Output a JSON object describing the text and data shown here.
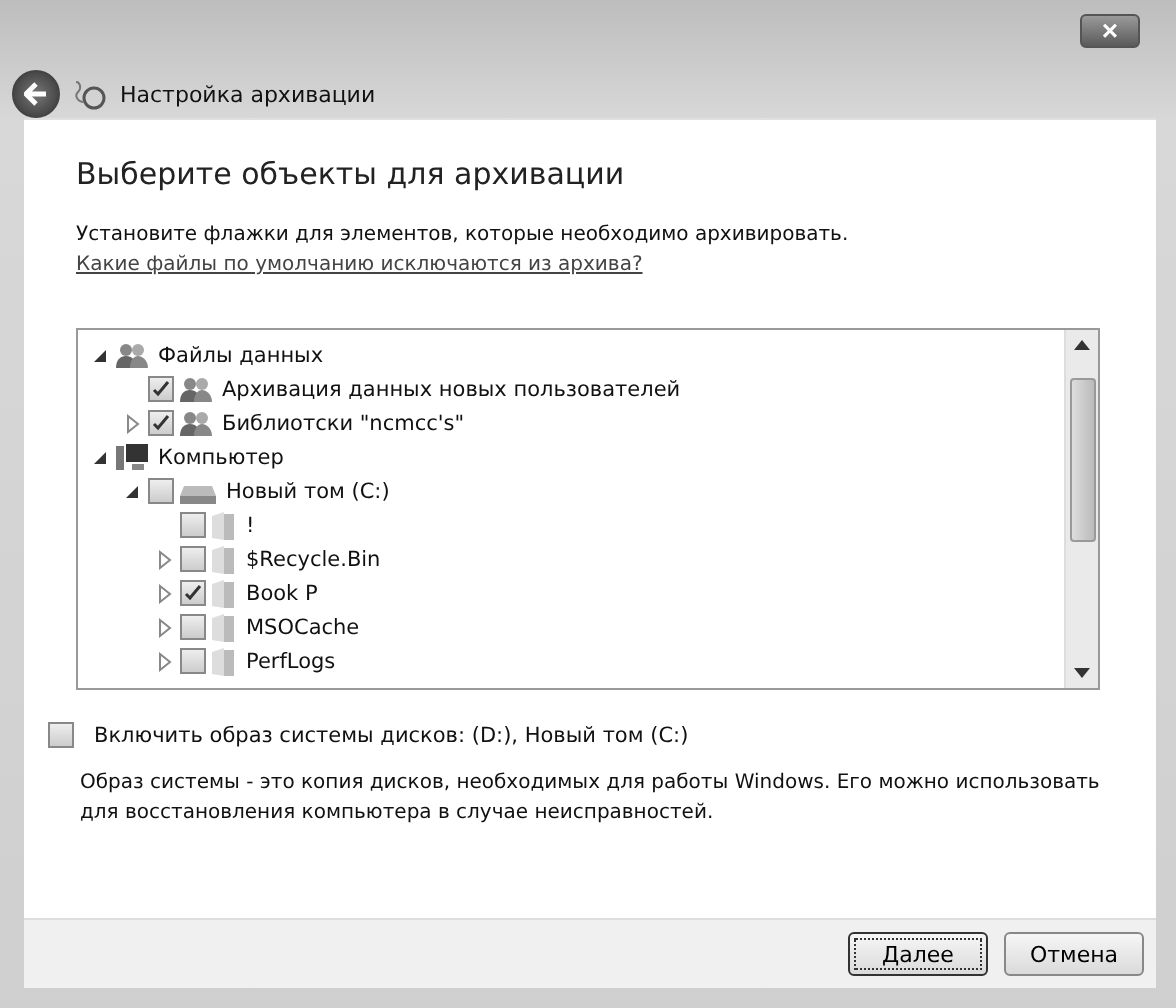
{
  "window": {
    "title": "Настройка архивации",
    "close": "×"
  },
  "heading": "Выберите объекты для архивации",
  "instruction": {
    "text": "Установите флажки для элементов, которые необходимо архивировать.",
    "link": "Какие файлы по умолчанию исключаются из архива?"
  },
  "tree": [
    {
      "label": "Файлы данных",
      "kind": "users",
      "expanded": true,
      "children": [
        {
          "label": "Архивация данных новых пользователей",
          "kind": "users",
          "checked": true
        },
        {
          "label": "Библиотски \"ncmcc's\"",
          "kind": "users",
          "checked": true,
          "expanded": false
        }
      ]
    },
    {
      "label": "Компьютер",
      "kind": "computer",
      "expanded": true,
      "children": [
        {
          "label": "Новый том (C:)",
          "kind": "drive",
          "checked": false,
          "expanded": true,
          "children": [
            {
              "label": "!",
              "kind": "folder",
              "checked": false
            },
            {
              "label": "$Recycle.Bin",
              "kind": "folder",
              "checked": false,
              "expanded": false
            },
            {
              "label": "Book P",
              "kind": "folder",
              "checked": true,
              "expanded": false
            },
            {
              "label": "MSOCache",
              "kind": "folder",
              "checked": false,
              "expanded": false
            },
            {
              "label": "PerfLogs",
              "kind": "folder",
              "checked": false,
              "expanded": false
            }
          ]
        }
      ]
    }
  ],
  "system_image": {
    "label": "Включить образ системы дисков: (D:), Новый том (C:)",
    "checked": false,
    "description": "Образ системы - это копия дисков, необходимых для работы Windows. Его можно использовать для восстановления компьютера в случае неисправностей."
  },
  "buttons": [
    {
      "label": "Далее",
      "default": true
    },
    {
      "label": "Отмена",
      "default": false
    }
  ]
}
